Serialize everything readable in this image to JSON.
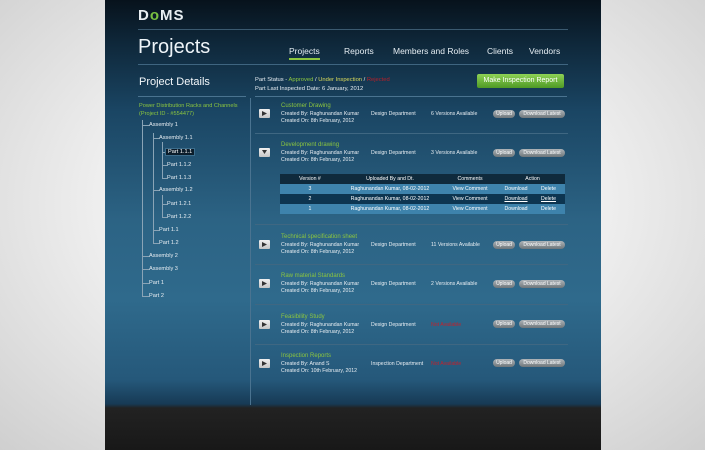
{
  "brand": {
    "pre": "D",
    "mid": "o",
    "post": "MS"
  },
  "page_title": "Projects",
  "nav": [
    "Projects",
    "Reports",
    "Members and Roles",
    "Clients",
    "Vendors"
  ],
  "project_details": {
    "title": "Project Details",
    "status": {
      "label": "Part Status - ",
      "approved": "Approved",
      "sep1": " / ",
      "under": "Under Inspection",
      "sep2": " / ",
      "rejected": "Rejected"
    },
    "last_inspected": "Part Last Inspected Date: 6 January, 2012",
    "make_report_button": "Make Inspection Report"
  },
  "tree": {
    "root_name": "Power Distribution Racks and Channels",
    "root_id": "(Project ID - #554477)",
    "nodes": [
      "Assembly 1",
      "Assembly 1.1",
      "Part 1.1.1",
      "Part 1.1.2",
      "Part 1.1.3",
      "Assembly 1.2",
      "Part 1.2.1",
      "Part 1.2.2",
      "Part 1.1",
      "Part 1.2",
      "Assembly 2",
      "Assembly 3",
      "Part 1",
      "Part 2"
    ],
    "selected": "Part 1.1.1"
  },
  "documents": [
    {
      "title": "Customer Drawing",
      "created_by": "Created By: Raghunandan Kumar",
      "created_on": "Created On: 8th February, 2012",
      "dept": "Design Department",
      "versions": "6 Versions Available",
      "upload": "Upload",
      "download": "Download Latest"
    },
    {
      "title": "Development drawing",
      "created_by": "Created By: Raghunandan Kumar",
      "created_on": "Created On: 8th February, 2012",
      "dept": "Design Department",
      "versions": "3 Versions Available",
      "upload": "Upload",
      "download": "Download Latest"
    },
    {
      "title": "Technical specification sheet",
      "created_by": "Created By: Raghunandan Kumar",
      "created_on": "Created On: 8th February, 2012",
      "dept": "Design Department",
      "versions": "11 Versions Available",
      "upload": "Upload",
      "download": "Download Latest"
    },
    {
      "title": "Raw material Standards",
      "created_by": "Created By: Raghunandan Kumar",
      "created_on": "Created On: 8th February, 2012",
      "dept": "Design Department",
      "versions": "2 Versions Available",
      "upload": "Upload",
      "download": "Download Latest"
    },
    {
      "title": "Feasibility Study",
      "created_by": "Created By: Raghunandan Kumar",
      "created_on": "Created On: 8th February, 2012",
      "dept": "Design Department",
      "versions": "Not Available",
      "upload": "Upload",
      "download": "Download Latest"
    },
    {
      "title": "Inspection Reports",
      "created_by": "Created By: Anand S",
      "created_on": "Created On: 10th February, 2012",
      "dept": "Inspection Department",
      "versions": "Not Available",
      "upload": "Upload",
      "download": "Download Latest"
    }
  ],
  "versions_table": {
    "headers": [
      "Version #",
      "Uploaded By and Dt.",
      "Comments",
      "Action"
    ],
    "rows": [
      {
        "version": "3",
        "uploaded": "Raghunandan Kumar, 08-02-2012",
        "comments": "View Comment",
        "download": "Download",
        "delete": "Delete"
      },
      {
        "version": "2",
        "uploaded": "Raghunandan Kumar, 08-02-2012",
        "comments": "View Comment",
        "download": "Download",
        "delete": "Delete"
      },
      {
        "version": "1",
        "uploaded": "Raghunandan Kumar, 08-02-2012",
        "comments": "View Comment",
        "download": "Download",
        "delete": "Delete"
      }
    ]
  },
  "colors": {
    "accent_green": "#8cc63f",
    "under_inspection": "#d8d95a",
    "rejected": "#b3202a",
    "not_available": "#c2222c"
  },
  "icons": [
    "expand-arrow-icon",
    "collapse-arrow-icon"
  ]
}
